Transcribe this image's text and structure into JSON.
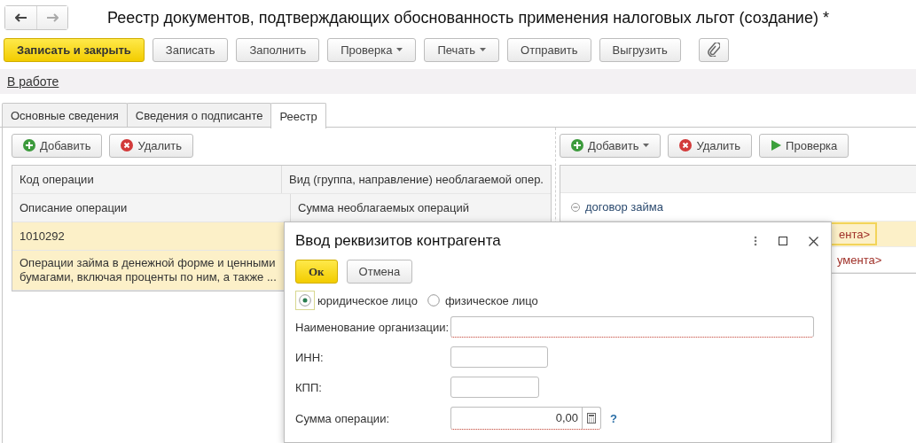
{
  "window": {
    "title": "Реестр документов, подтверждающих обоснованность применения налоговых льгот (создание) *"
  },
  "toolbar": [
    {
      "label": "Записать и закрыть",
      "kind": "primary"
    },
    {
      "label": "Записать",
      "kind": "plain"
    },
    {
      "label": "Заполнить",
      "kind": "plain"
    },
    {
      "label": "Проверка",
      "kind": "menu"
    },
    {
      "label": "Печать",
      "kind": "menu"
    },
    {
      "label": "Отправить",
      "kind": "plain"
    },
    {
      "label": "Выгрузить",
      "kind": "plain"
    },
    {
      "kind": "attach"
    }
  ],
  "status_link": "В работе",
  "tabs": [
    {
      "label": "Основные сведения",
      "selected": false
    },
    {
      "label": "Сведения о подписанте",
      "selected": false
    },
    {
      "label": "Реестр",
      "selected": true
    }
  ],
  "operations": {
    "toolbar": [
      {
        "label": "Добавить",
        "kind": "add"
      },
      {
        "label": "Удалить",
        "kind": "delete"
      }
    ],
    "header_rows": [
      [
        "Код операции",
        "Вид (группа, направление) необлагаемой опер."
      ],
      [
        "Описание операции",
        "Сумма необлагаемых операций"
      ]
    ],
    "rows": [
      {
        "code": "1010292",
        "description": "Операции займа в денежной форме и ценными бумагами, включая проценты по ним, а также ...",
        "selected": true
      }
    ]
  },
  "documents": {
    "toolbar": [
      {
        "label": "Добавить",
        "kind": "add",
        "menu": true
      },
      {
        "label": "Удалить",
        "kind": "delete",
        "menu": false
      },
      {
        "label": "Проверка",
        "kind": "run",
        "menu": false
      }
    ],
    "groups": [
      {
        "label": "договор займа",
        "expanded": true,
        "children": [
          {
            "text": "ента>",
            "selected": true
          },
          {
            "text": "умента>",
            "selected": false
          }
        ]
      }
    ]
  },
  "dialog": {
    "title": "Ввод реквизитов контрагента",
    "buttons": [
      {
        "label": "Ок",
        "kind": "primary"
      },
      {
        "label": "Отмена",
        "kind": "plain"
      }
    ],
    "radios": [
      {
        "label": "юридическое лицо",
        "selected": true
      },
      {
        "label": "физическое лицо",
        "selected": false
      }
    ],
    "fields": [
      {
        "label": "Наименование организации:",
        "kind": "text",
        "required": true
      },
      {
        "label": "ИНН:",
        "kind": "text",
        "required": false
      },
      {
        "label": "КПП:",
        "kind": "text",
        "required": false
      },
      {
        "label": "Сумма операции:",
        "kind": "amount",
        "required": true,
        "value": "0,00",
        "help": "?"
      }
    ]
  }
}
